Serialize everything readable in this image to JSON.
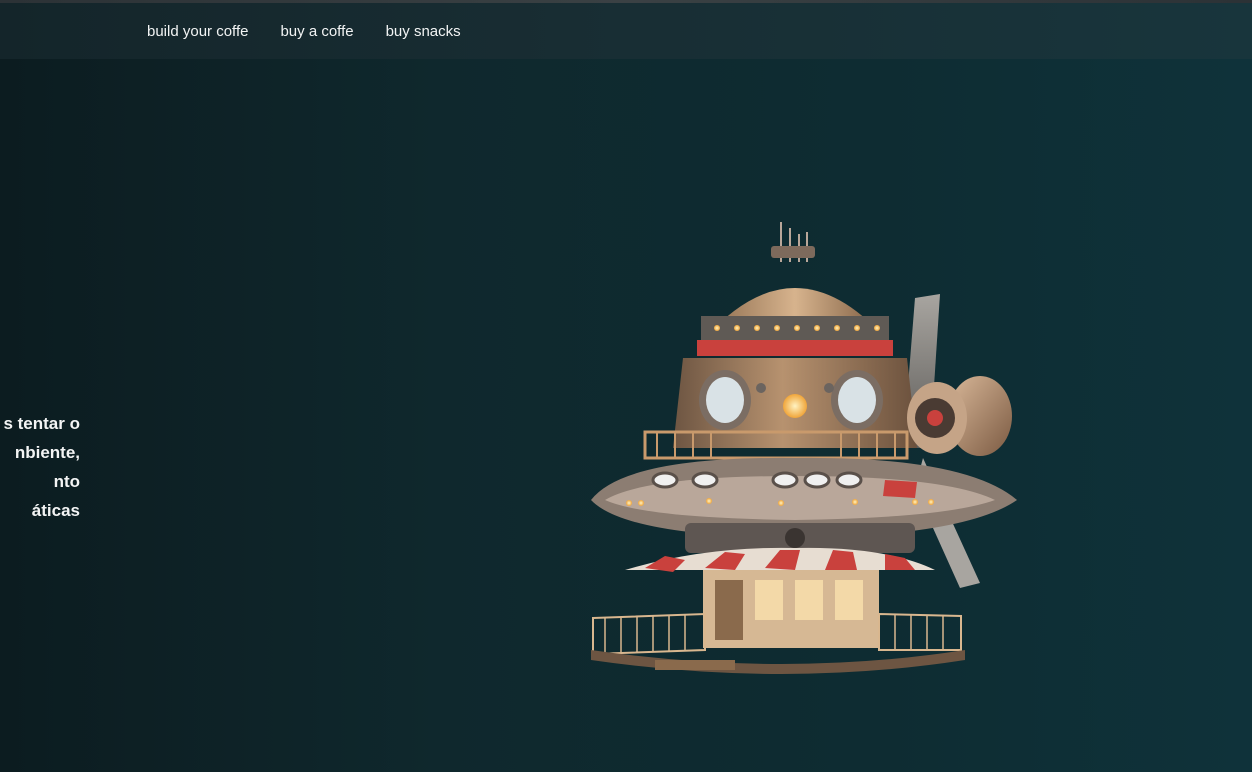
{
  "nav": {
    "items": [
      {
        "label": "build your coffe"
      },
      {
        "label": "buy a coffe"
      },
      {
        "label": "buy snacks"
      }
    ]
  },
  "hero": {
    "lines": [
      "s tentar o",
      "nbiente,",
      "nto",
      "áticas"
    ]
  },
  "image": {
    "subject": "spaceship-coffee-shop-illustration"
  },
  "colors": {
    "background": "#0e2529",
    "navbar": "#182d33",
    "text": "#f2f4f4",
    "accent_red": "#c9413d",
    "wood": "#c99a6c"
  }
}
